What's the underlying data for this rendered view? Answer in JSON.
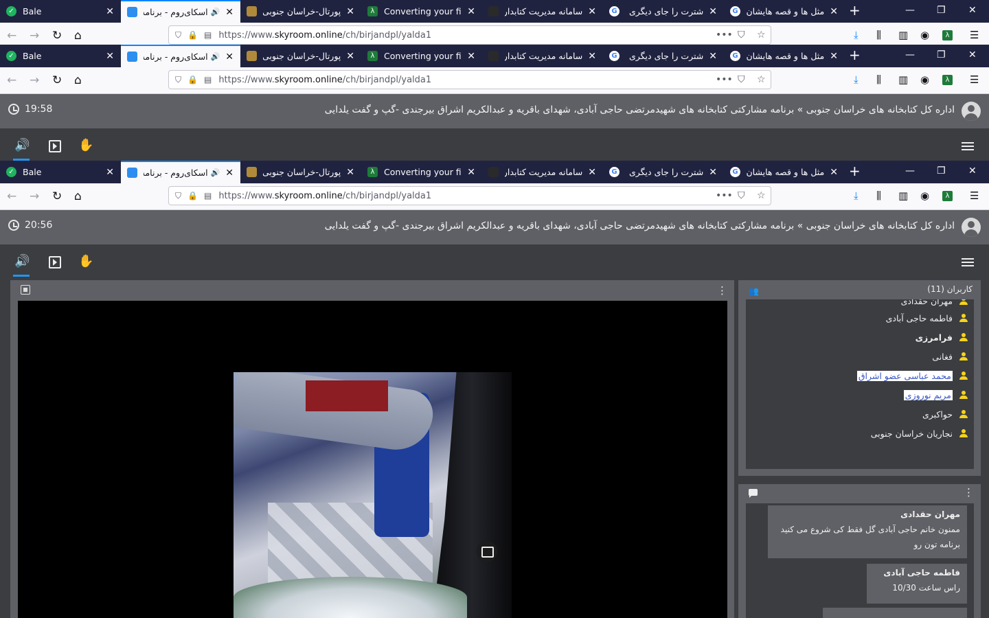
{
  "browser": {
    "tabs": [
      {
        "title": "Bale",
        "favicon": "bale-logo-icon",
        "color": "#1fb45f"
      },
      {
        "title": "اسکای‌روم - برنامه",
        "favicon": "skyroom-logo-icon",
        "color": "#2d8ef0",
        "audio": "🔊"
      },
      {
        "title": "پورتال-خراسان جنوبی-",
        "favicon": "portal-logo-icon",
        "color": "#b08a3a"
      },
      {
        "title": "Converting your file",
        "favicon": "converter-logo-icon",
        "color": "#1e7b3a"
      },
      {
        "title": "سامانه مدیریت کتابداری",
        "favicon": "book-logo-icon",
        "color": "#2a2a2a"
      },
      {
        "title": "شترت را جای دیگری بخو",
        "favicon": "google-logo-icon",
        "color": "#ffffff"
      },
      {
        "title": "مثل ها و قصه هایشان",
        "favicon": "google-logo-icon",
        "color": "#ffffff"
      }
    ],
    "url": {
      "scheme": "https://www.",
      "host": "skyroom.online",
      "path": "/ch/birjandpl/yalda1"
    }
  },
  "app": {
    "clock_top": "19:58",
    "clock": "20:56",
    "room_title": "اداره کل کتابخانه های خراسان جنوبی » برنامه مشارکتی کتابخانه های شهیدمرتضی حاجی آبادی، شهدای باقریه و عبدالکریم اشراق بیرجندی -گپ و گفت یلدایی"
  },
  "users": {
    "header": "کاربران (11)",
    "items": [
      {
        "name": "مهران حقدادی",
        "style": "normal"
      },
      {
        "name": "فاطمه حاجی آبادی",
        "style": "normal"
      },
      {
        "name": "فرامرزی",
        "style": "bold"
      },
      {
        "name": "فغانی",
        "style": "normal"
      },
      {
        "name": "محمد عباسی عضو اشراق",
        "style": "highlight"
      },
      {
        "name": "مریم نوروزی",
        "style": "highlight"
      },
      {
        "name": "حواکبری",
        "style": "normal"
      },
      {
        "name": "نجاریان خراسان جنوبی",
        "style": "normal"
      }
    ]
  },
  "chat": {
    "messages": [
      {
        "sender": "مهران حقدادی",
        "text": "ممنون خانم حاجی آبادی گل فقط کی شروع می کنید برنامه تون رو"
      },
      {
        "sender": "فاطمه حاجی آبادی",
        "text": "راس ساعت 10/30"
      }
    ]
  }
}
